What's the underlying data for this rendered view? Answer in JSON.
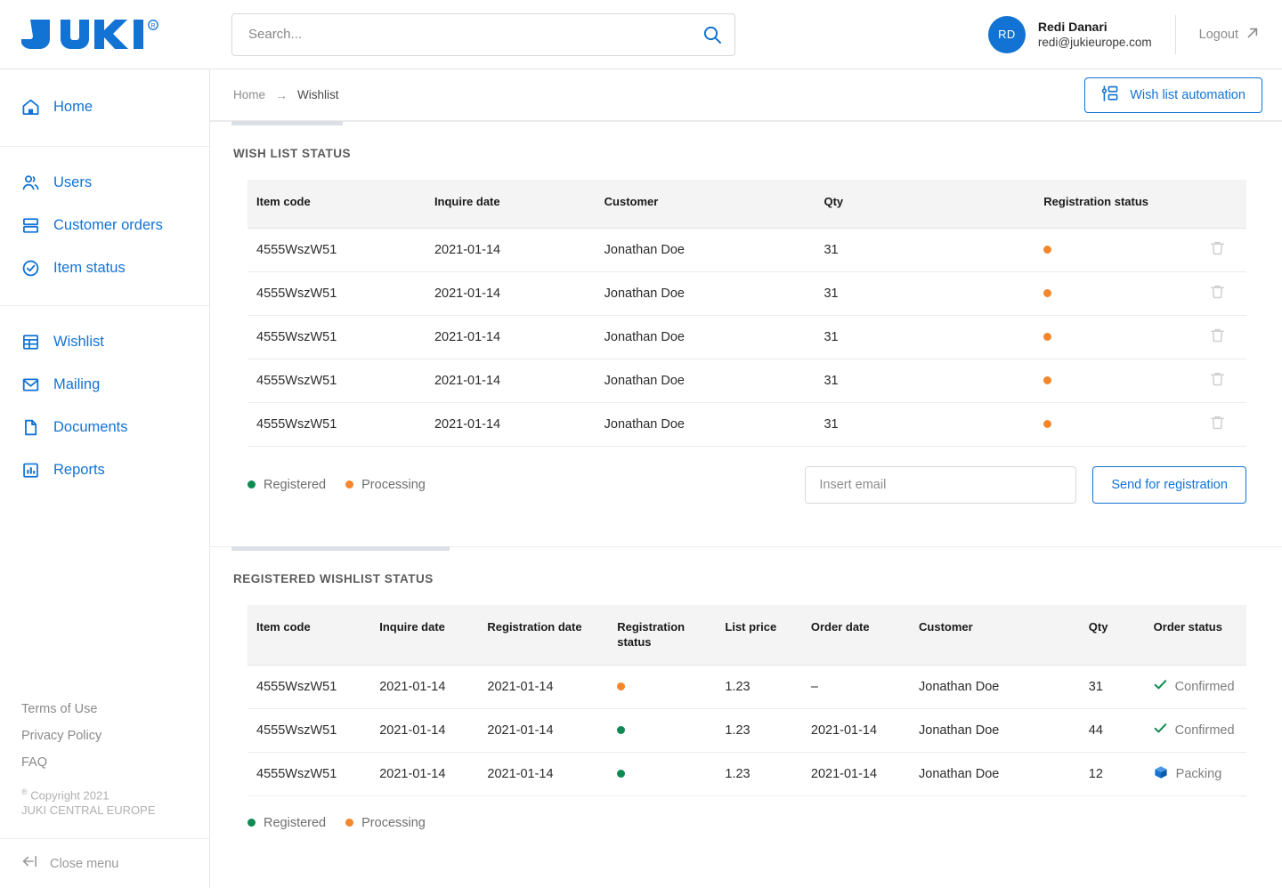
{
  "brand": {
    "logo_text": "JUKI",
    "registered_mark": "®"
  },
  "search": {
    "placeholder": "Search...",
    "value": "",
    "icon": "search-icon"
  },
  "user": {
    "initials": "RD",
    "name": "Redi Danari",
    "email": "redi@jukieurope.com",
    "logout_label": "Logout",
    "logout_icon": "external-link-icon"
  },
  "sidebar": {
    "groups": [
      {
        "items": [
          {
            "label": "Home",
            "icon": "home-icon"
          }
        ]
      },
      {
        "items": [
          {
            "label": "Users",
            "icon": "users-icon"
          },
          {
            "label": "Customer orders",
            "icon": "stacked-rows-icon"
          },
          {
            "label": "Item status",
            "icon": "check-circle-icon"
          }
        ]
      },
      {
        "items": [
          {
            "label": "Wishlist",
            "icon": "table-grid-icon"
          },
          {
            "label": "Mailing",
            "icon": "envelope-icon"
          },
          {
            "label": "Documents",
            "icon": "document-icon"
          },
          {
            "label": "Reports",
            "icon": "bar-chart-icon"
          }
        ]
      }
    ],
    "links": [
      "Terms of Use",
      "Privacy Policy",
      "FAQ"
    ],
    "copyright_mark": "®",
    "copyright_line1": " Copyright 2021",
    "copyright_line2": "JUKI CENTRAL EUROPE",
    "close_menu_label": "Close menu",
    "close_menu_icon": "arrow-left-bar-icon"
  },
  "breadcrumb": {
    "home": "Home",
    "arrow": "→",
    "current": "Wishlist"
  },
  "automation_button": {
    "label": "Wish list automation",
    "icon": "sliders-icon"
  },
  "section1": {
    "title": "WISH LIST STATUS",
    "columns": [
      "Item code",
      "Inquire date",
      "Customer",
      "Qty",
      "Registration status",
      ""
    ],
    "rows": [
      {
        "item_code": "4555WszW51",
        "inquire_date": "2021-01-14",
        "customer": "Jonathan Doe",
        "qty": "31",
        "status": "processing",
        "action": "delete-icon"
      },
      {
        "item_code": "4555WszW51",
        "inquire_date": "2021-01-14",
        "customer": "Jonathan Doe",
        "qty": "31",
        "status": "processing",
        "action": "delete-icon"
      },
      {
        "item_code": "4555WszW51",
        "inquire_date": "2021-01-14",
        "customer": "Jonathan Doe",
        "qty": "31",
        "status": "processing",
        "action": "delete-icon"
      },
      {
        "item_code": "4555WszW51",
        "inquire_date": "2021-01-14",
        "customer": "Jonathan Doe",
        "qty": "31",
        "status": "processing",
        "action": "delete-icon"
      },
      {
        "item_code": "4555WszW51",
        "inquire_date": "2021-01-14",
        "customer": "Jonathan Doe",
        "qty": "31",
        "status": "processing",
        "action": "delete-icon"
      }
    ],
    "legend": [
      {
        "label": "Registered",
        "color": "#0f8a53"
      },
      {
        "label": "Processing",
        "color": "#f4862b"
      }
    ],
    "email_placeholder": "Insert email",
    "email_value": "",
    "send_label": "Send for registration"
  },
  "section2": {
    "title": "REGISTERED WISHLIST STATUS",
    "columns": [
      "Item code",
      "Inquire date",
      "Registration date",
      "Registration status",
      "List price",
      "Order date",
      "Customer",
      "Qty",
      "Order status"
    ],
    "rows": [
      {
        "item_code": "4555WszW51",
        "inquire_date": "2021-01-14",
        "registration_date": "2021-01-14",
        "reg_status": "processing",
        "list_price": "1.23",
        "order_date": "–",
        "customer": "Jonathan Doe",
        "qty": "31",
        "order_status": "Confirmed",
        "order_status_icon": "check-icon"
      },
      {
        "item_code": "4555WszW51",
        "inquire_date": "2021-01-14",
        "registration_date": "2021-01-14",
        "reg_status": "registered",
        "list_price": "1.23",
        "order_date": "2021-01-14",
        "customer": "Jonathan Doe",
        "qty": "44",
        "order_status": "Confirmed",
        "order_status_icon": "check-icon"
      },
      {
        "item_code": "4555WszW51",
        "inquire_date": "2021-01-14",
        "registration_date": "2021-01-14",
        "reg_status": "registered",
        "list_price": "1.23",
        "order_date": "2021-01-14",
        "customer": "Jonathan Doe",
        "qty": "12",
        "order_status": "Packing",
        "order_status_icon": "package-box-icon"
      }
    ],
    "legend": [
      {
        "label": "Registered",
        "color": "#0f8a53"
      },
      {
        "label": "Processing",
        "color": "#f4862b"
      }
    ]
  },
  "colors": {
    "brand_blue": "#1273d4",
    "status_registered": "#0f8a53",
    "status_processing": "#f4862b",
    "header_bg": "#f4f4f4",
    "tab_indicator": "#dcdfe6"
  }
}
